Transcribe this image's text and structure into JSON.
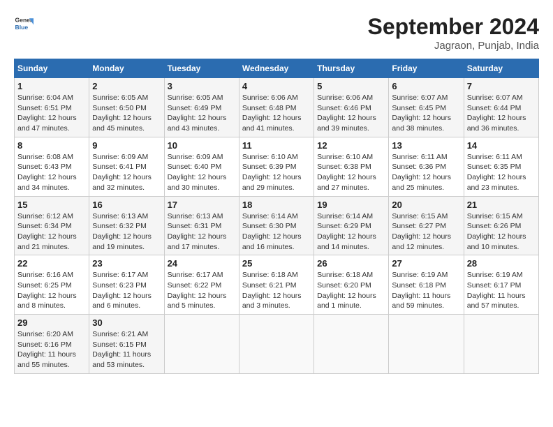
{
  "header": {
    "logo_line1": "General",
    "logo_line2": "Blue",
    "month_title": "September 2024",
    "location": "Jagraon, Punjab, India"
  },
  "days_of_week": [
    "Sunday",
    "Monday",
    "Tuesday",
    "Wednesday",
    "Thursday",
    "Friday",
    "Saturday"
  ],
  "weeks": [
    [
      {
        "day": "1",
        "sunrise": "Sunrise: 6:04 AM",
        "sunset": "Sunset: 6:51 PM",
        "daylight": "Daylight: 12 hours and 47 minutes."
      },
      {
        "day": "2",
        "sunrise": "Sunrise: 6:05 AM",
        "sunset": "Sunset: 6:50 PM",
        "daylight": "Daylight: 12 hours and 45 minutes."
      },
      {
        "day": "3",
        "sunrise": "Sunrise: 6:05 AM",
        "sunset": "Sunset: 6:49 PM",
        "daylight": "Daylight: 12 hours and 43 minutes."
      },
      {
        "day": "4",
        "sunrise": "Sunrise: 6:06 AM",
        "sunset": "Sunset: 6:48 PM",
        "daylight": "Daylight: 12 hours and 41 minutes."
      },
      {
        "day": "5",
        "sunrise": "Sunrise: 6:06 AM",
        "sunset": "Sunset: 6:46 PM",
        "daylight": "Daylight: 12 hours and 39 minutes."
      },
      {
        "day": "6",
        "sunrise": "Sunrise: 6:07 AM",
        "sunset": "Sunset: 6:45 PM",
        "daylight": "Daylight: 12 hours and 38 minutes."
      },
      {
        "day": "7",
        "sunrise": "Sunrise: 6:07 AM",
        "sunset": "Sunset: 6:44 PM",
        "daylight": "Daylight: 12 hours and 36 minutes."
      }
    ],
    [
      {
        "day": "8",
        "sunrise": "Sunrise: 6:08 AM",
        "sunset": "Sunset: 6:43 PM",
        "daylight": "Daylight: 12 hours and 34 minutes."
      },
      {
        "day": "9",
        "sunrise": "Sunrise: 6:09 AM",
        "sunset": "Sunset: 6:41 PM",
        "daylight": "Daylight: 12 hours and 32 minutes."
      },
      {
        "day": "10",
        "sunrise": "Sunrise: 6:09 AM",
        "sunset": "Sunset: 6:40 PM",
        "daylight": "Daylight: 12 hours and 30 minutes."
      },
      {
        "day": "11",
        "sunrise": "Sunrise: 6:10 AM",
        "sunset": "Sunset: 6:39 PM",
        "daylight": "Daylight: 12 hours and 29 minutes."
      },
      {
        "day": "12",
        "sunrise": "Sunrise: 6:10 AM",
        "sunset": "Sunset: 6:38 PM",
        "daylight": "Daylight: 12 hours and 27 minutes."
      },
      {
        "day": "13",
        "sunrise": "Sunrise: 6:11 AM",
        "sunset": "Sunset: 6:36 PM",
        "daylight": "Daylight: 12 hours and 25 minutes."
      },
      {
        "day": "14",
        "sunrise": "Sunrise: 6:11 AM",
        "sunset": "Sunset: 6:35 PM",
        "daylight": "Daylight: 12 hours and 23 minutes."
      }
    ],
    [
      {
        "day": "15",
        "sunrise": "Sunrise: 6:12 AM",
        "sunset": "Sunset: 6:34 PM",
        "daylight": "Daylight: 12 hours and 21 minutes."
      },
      {
        "day": "16",
        "sunrise": "Sunrise: 6:13 AM",
        "sunset": "Sunset: 6:32 PM",
        "daylight": "Daylight: 12 hours and 19 minutes."
      },
      {
        "day": "17",
        "sunrise": "Sunrise: 6:13 AM",
        "sunset": "Sunset: 6:31 PM",
        "daylight": "Daylight: 12 hours and 17 minutes."
      },
      {
        "day": "18",
        "sunrise": "Sunrise: 6:14 AM",
        "sunset": "Sunset: 6:30 PM",
        "daylight": "Daylight: 12 hours and 16 minutes."
      },
      {
        "day": "19",
        "sunrise": "Sunrise: 6:14 AM",
        "sunset": "Sunset: 6:29 PM",
        "daylight": "Daylight: 12 hours and 14 minutes."
      },
      {
        "day": "20",
        "sunrise": "Sunrise: 6:15 AM",
        "sunset": "Sunset: 6:27 PM",
        "daylight": "Daylight: 12 hours and 12 minutes."
      },
      {
        "day": "21",
        "sunrise": "Sunrise: 6:15 AM",
        "sunset": "Sunset: 6:26 PM",
        "daylight": "Daylight: 12 hours and 10 minutes."
      }
    ],
    [
      {
        "day": "22",
        "sunrise": "Sunrise: 6:16 AM",
        "sunset": "Sunset: 6:25 PM",
        "daylight": "Daylight: 12 hours and 8 minutes."
      },
      {
        "day": "23",
        "sunrise": "Sunrise: 6:17 AM",
        "sunset": "Sunset: 6:23 PM",
        "daylight": "Daylight: 12 hours and 6 minutes."
      },
      {
        "day": "24",
        "sunrise": "Sunrise: 6:17 AM",
        "sunset": "Sunset: 6:22 PM",
        "daylight": "Daylight: 12 hours and 5 minutes."
      },
      {
        "day": "25",
        "sunrise": "Sunrise: 6:18 AM",
        "sunset": "Sunset: 6:21 PM",
        "daylight": "Daylight: 12 hours and 3 minutes."
      },
      {
        "day": "26",
        "sunrise": "Sunrise: 6:18 AM",
        "sunset": "Sunset: 6:20 PM",
        "daylight": "Daylight: 12 hours and 1 minute."
      },
      {
        "day": "27",
        "sunrise": "Sunrise: 6:19 AM",
        "sunset": "Sunset: 6:18 PM",
        "daylight": "Daylight: 11 hours and 59 minutes."
      },
      {
        "day": "28",
        "sunrise": "Sunrise: 6:19 AM",
        "sunset": "Sunset: 6:17 PM",
        "daylight": "Daylight: 11 hours and 57 minutes."
      }
    ],
    [
      {
        "day": "29",
        "sunrise": "Sunrise: 6:20 AM",
        "sunset": "Sunset: 6:16 PM",
        "daylight": "Daylight: 11 hours and 55 minutes."
      },
      {
        "day": "30",
        "sunrise": "Sunrise: 6:21 AM",
        "sunset": "Sunset: 6:15 PM",
        "daylight": "Daylight: 11 hours and 53 minutes."
      },
      null,
      null,
      null,
      null,
      null
    ]
  ]
}
